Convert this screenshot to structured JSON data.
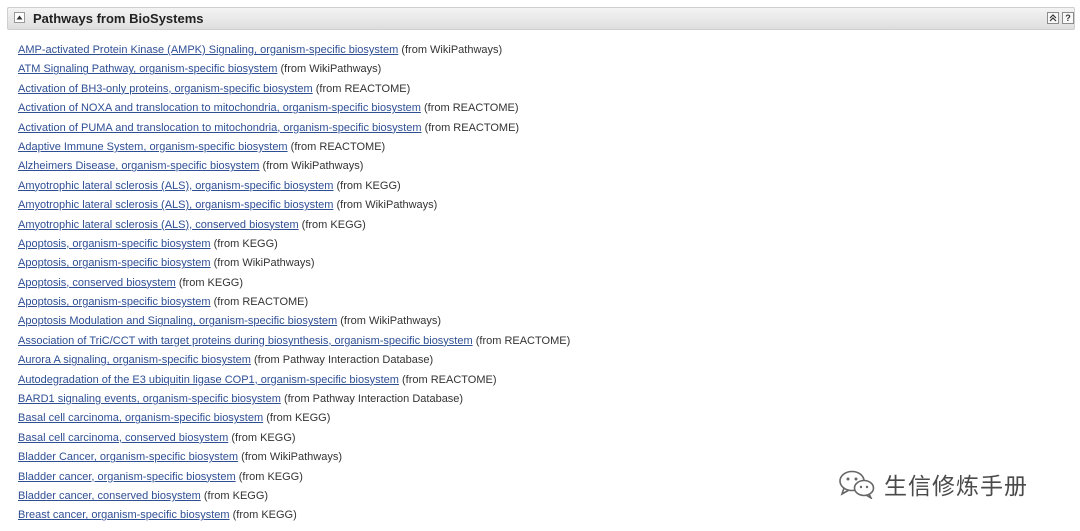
{
  "section": {
    "title": "Pathways from BioSystems",
    "help_label": "?"
  },
  "icons": {
    "toggle": "triangle-up-icon",
    "collapse": "double-chevron-up-icon",
    "help": "question-mark-icon",
    "watermark": "wechat-logo-icon"
  },
  "pathways": [
    {
      "name": "AMP-activated Protein Kinase (AMPK) Signaling, organism-specific biosystem",
      "source": "(from WikiPathways)"
    },
    {
      "name": "ATM Signaling Pathway, organism-specific biosystem",
      "source": "(from WikiPathways)"
    },
    {
      "name": "Activation of BH3-only proteins, organism-specific biosystem",
      "source": "(from REACTOME)"
    },
    {
      "name": "Activation of NOXA and translocation to mitochondria, organism-specific biosystem",
      "source": "(from REACTOME)"
    },
    {
      "name": "Activation of PUMA and translocation to mitochondria, organism-specific biosystem",
      "source": "(from REACTOME)"
    },
    {
      "name": "Adaptive Immune System, organism-specific biosystem",
      "source": "(from REACTOME)"
    },
    {
      "name": "Alzheimers Disease, organism-specific biosystem",
      "source": "(from WikiPathways)"
    },
    {
      "name": "Amyotrophic lateral sclerosis (ALS), organism-specific biosystem",
      "source": "(from KEGG)"
    },
    {
      "name": "Amyotrophic lateral sclerosis (ALS), organism-specific biosystem",
      "source": "(from WikiPathways)"
    },
    {
      "name": "Amyotrophic lateral sclerosis (ALS), conserved biosystem",
      "source": "(from KEGG)"
    },
    {
      "name": "Apoptosis, organism-specific biosystem",
      "source": "(from KEGG)"
    },
    {
      "name": "Apoptosis, organism-specific biosystem",
      "source": "(from WikiPathways)"
    },
    {
      "name": "Apoptosis, conserved biosystem",
      "source": "(from KEGG)"
    },
    {
      "name": "Apoptosis, organism-specific biosystem",
      "source": "(from REACTOME)"
    },
    {
      "name": "Apoptosis Modulation and Signaling, organism-specific biosystem",
      "source": "(from WikiPathways)"
    },
    {
      "name": "Association of TriC/CCT with target proteins during biosynthesis, organism-specific biosystem",
      "source": "(from REACTOME)"
    },
    {
      "name": "Aurora A signaling, organism-specific biosystem",
      "source": "(from Pathway Interaction Database)"
    },
    {
      "name": "Autodegradation of the E3 ubiquitin ligase COP1, organism-specific biosystem",
      "source": "(from REACTOME)"
    },
    {
      "name": "BARD1 signaling events, organism-specific biosystem",
      "source": "(from Pathway Interaction Database)"
    },
    {
      "name": "Basal cell carcinoma, organism-specific biosystem",
      "source": "(from KEGG)"
    },
    {
      "name": "Basal cell carcinoma, conserved biosystem",
      "source": "(from KEGG)"
    },
    {
      "name": "Bladder Cancer, organism-specific biosystem",
      "source": "(from WikiPathways)"
    },
    {
      "name": "Bladder cancer, organism-specific biosystem",
      "source": "(from KEGG)"
    },
    {
      "name": "Bladder cancer, conserved biosystem",
      "source": "(from KEGG)"
    },
    {
      "name": "Breast cancer, organism-specific biosystem",
      "source": "(from KEGG)"
    }
  ],
  "watermark": {
    "text": "生信修炼手册"
  }
}
